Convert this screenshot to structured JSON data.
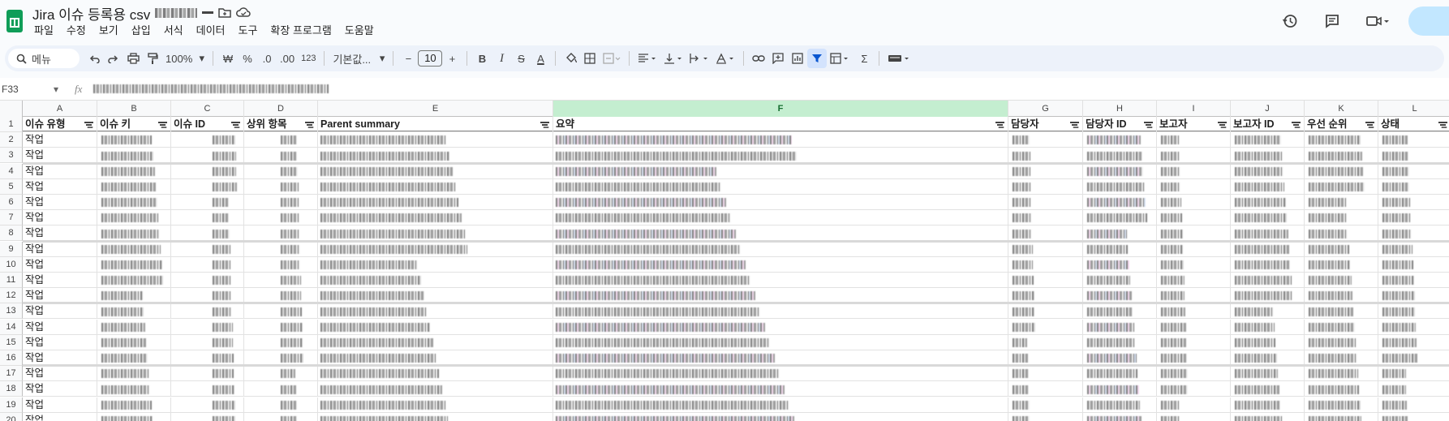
{
  "doc": {
    "title": "Jira 이슈 등록용 csv",
    "title_redacted_suffix": ""
  },
  "menu": [
    "파일",
    "수정",
    "보기",
    "삽입",
    "서식",
    "데이터",
    "도구",
    "확장 프로그램",
    "도움말"
  ],
  "toolbar": {
    "search_label": "메뉴",
    "zoom": "100%",
    "currency": "₩",
    "percent": "%",
    "dec_decrease": ".0",
    "dec_increase": ".00",
    "number_format": "123",
    "font_name": "기본값...",
    "font_size": "10",
    "bold": "B",
    "italic": "I",
    "strike": "S",
    "text_color": "A"
  },
  "formula_bar": {
    "cell_ref": "F33",
    "fx": "fx"
  },
  "columns": [
    {
      "letter": "A",
      "header": "이슈 유형"
    },
    {
      "letter": "B",
      "header": "이슈 키"
    },
    {
      "letter": "C",
      "header": "이슈 ID"
    },
    {
      "letter": "D",
      "header": "상위 항목"
    },
    {
      "letter": "E",
      "header": "Parent summary"
    },
    {
      "letter": "F",
      "header": "요약"
    },
    {
      "letter": "G",
      "header": "담당자"
    },
    {
      "letter": "H",
      "header": "담당자 ID"
    },
    {
      "letter": "I",
      "header": "보고자"
    },
    {
      "letter": "J",
      "header": "보고자 ID"
    },
    {
      "letter": "K",
      "header": "우선 순위"
    },
    {
      "letter": "L",
      "header": "상태"
    }
  ],
  "selected_column": "F",
  "rows": [
    {
      "num": "1"
    },
    {
      "num": "2",
      "type": "작업"
    },
    {
      "num": "3",
      "type": "작업"
    },
    {
      "num": "4",
      "type": "작업"
    },
    {
      "num": "5",
      "type": "작업"
    },
    {
      "num": "6",
      "type": "작업"
    },
    {
      "num": "7",
      "type": "작업"
    },
    {
      "num": "8",
      "type": "작업"
    },
    {
      "num": "9",
      "type": "작업"
    },
    {
      "num": "10",
      "type": "작업"
    },
    {
      "num": "11",
      "type": "작업"
    },
    {
      "num": "12",
      "type": "작업"
    },
    {
      "num": "13",
      "type": "작업"
    },
    {
      "num": "14",
      "type": "작업"
    },
    {
      "num": "15",
      "type": "작업"
    },
    {
      "num": "16",
      "type": "작업"
    },
    {
      "num": "17",
      "type": "작업"
    },
    {
      "num": "18",
      "type": "작업"
    },
    {
      "num": "19",
      "type": "작업"
    },
    {
      "num": "20",
      "type": "작업"
    }
  ],
  "colors": {
    "accent": "#0b57d0",
    "selected_col": "#c4eed0",
    "toolbar_bg": "#edf2fa",
    "share_bg": "#c2e7ff"
  }
}
